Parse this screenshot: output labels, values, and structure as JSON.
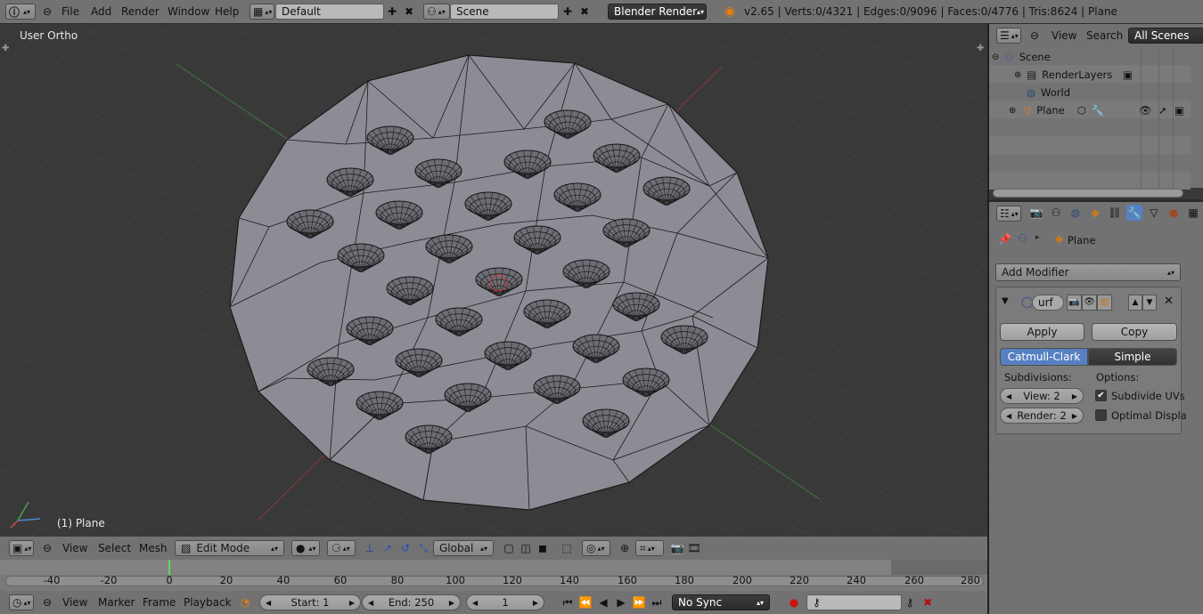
{
  "top_menu": [
    "File",
    "Add",
    "Render",
    "Window",
    "Help"
  ],
  "layout_name": "Default",
  "scene_name": "Scene",
  "render_engine": "Blender Render",
  "stats": "v2.65 | Verts:0/4321 | Edges:0/9096 | Faces:0/4776 | Tris:8624 | Plane",
  "viewport": {
    "view_label": "User Ortho",
    "object_label": "(1) Plane"
  },
  "view3d_header": {
    "menus": [
      "View",
      "Select",
      "Mesh"
    ],
    "mode": "Edit Mode",
    "orientation": "Global"
  },
  "outliner": {
    "menus": [
      "View",
      "Search"
    ],
    "filter": "All Scenes",
    "items": [
      "Scene",
      "RenderLayers",
      "World",
      "Plane"
    ]
  },
  "properties": {
    "breadcrumb": "Plane",
    "add_modifier": "Add Modifier",
    "modifier_name": "urf",
    "apply": "Apply",
    "copy": "Copy",
    "type_a": "Catmull-Clark",
    "type_b": "Simple",
    "subdivisions_label": "Subdivisions:",
    "options_label": "Options:",
    "view_field": "View: 2",
    "render_field": "Render: 2",
    "opt1": "Subdivide UVs",
    "opt2": "Optimal Displa"
  },
  "timeline": {
    "ticks": [
      "-40",
      "-20",
      "0",
      "20",
      "40",
      "60",
      "80",
      "100",
      "120",
      "140",
      "160",
      "180",
      "200",
      "220",
      "240",
      "260",
      "280"
    ],
    "menus": [
      "View",
      "Marker",
      "Frame",
      "Playback"
    ],
    "start": "Start: 1",
    "end": "End: 250",
    "current": "1",
    "sync": "No Sync"
  },
  "colors": {
    "header": "#727272",
    "viewport_bg": "#393939",
    "mesh": "#8a8a93",
    "accent_blue": "#5680c2"
  }
}
